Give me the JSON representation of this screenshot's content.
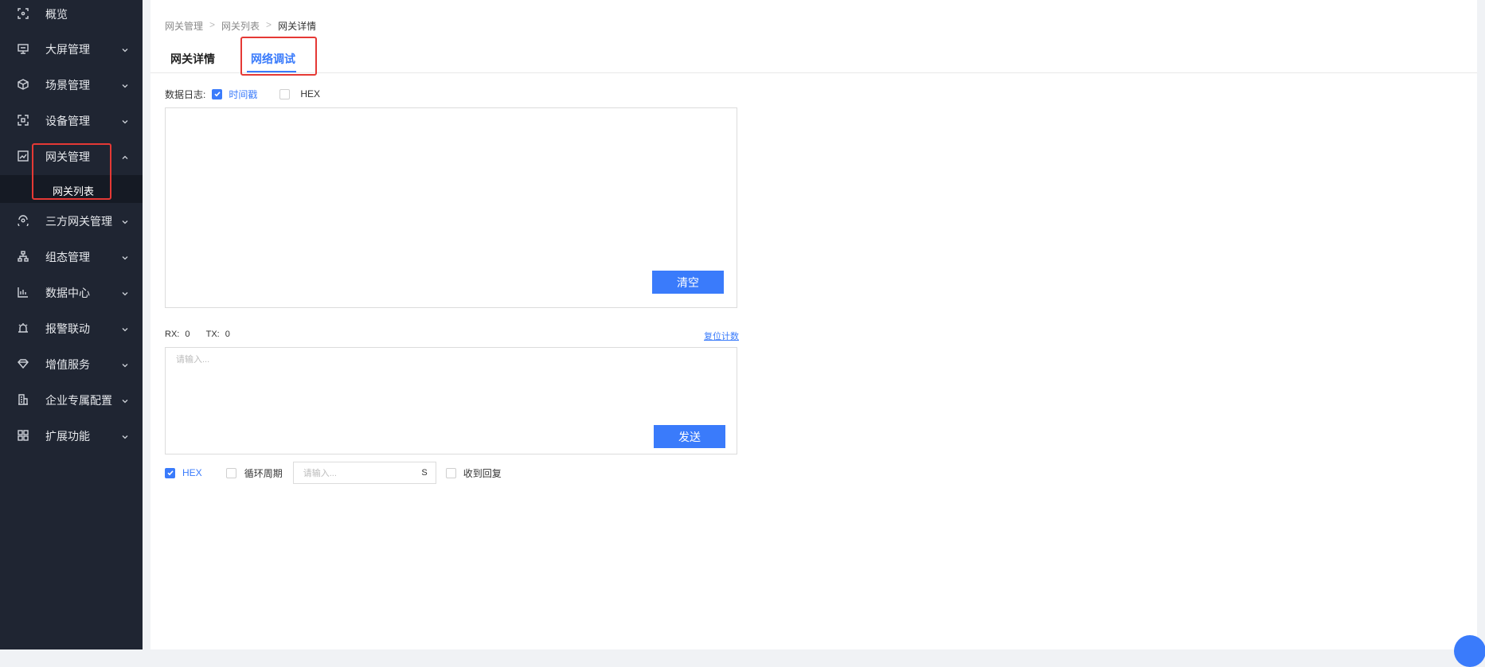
{
  "sidebar": {
    "items": [
      {
        "label": "概览",
        "icon": "overview-icon"
      },
      {
        "label": "大屏管理",
        "icon": "monitor-icon"
      },
      {
        "label": "场景管理",
        "icon": "cube-icon"
      },
      {
        "label": "设备管理",
        "icon": "device-icon"
      },
      {
        "label": "网关管理",
        "icon": "gateway-icon"
      },
      {
        "label": "三方网关管理",
        "icon": "third-party-icon"
      },
      {
        "label": "组态管理",
        "icon": "hierarchy-icon"
      },
      {
        "label": "数据中心",
        "icon": "bar-chart-icon"
      },
      {
        "label": "报警联动",
        "icon": "alarm-icon"
      },
      {
        "label": "增值服务",
        "icon": "diamond-icon"
      },
      {
        "label": "企业专属配置",
        "icon": "building-icon"
      },
      {
        "label": "扩展功能",
        "icon": "grid-icon"
      }
    ],
    "sub_item": "网关列表"
  },
  "breadcrumb": [
    "网关管理",
    "网关列表",
    "网关详情"
  ],
  "tabs": [
    "网关详情",
    "网络调试"
  ],
  "log": {
    "label": "数据日志:",
    "timestamp_label": "时间戳",
    "hex_label": "HEX",
    "clear_button": "清空"
  },
  "counters": {
    "rx_label": "RX:",
    "rx": "0",
    "tx_label": "TX:",
    "tx": "0",
    "reset_link": "复位计数"
  },
  "send": {
    "placeholder": "请输入...",
    "send_button": "发送",
    "hex_label": "HEX",
    "loop_label": "循环周期",
    "period_placeholder": "请输入...",
    "period_unit": "S",
    "reply_label": "收到回复"
  },
  "colors": {
    "sidebar_bg": "#1f2532",
    "accent": "#3a7bfb",
    "annotation": "#e53935"
  }
}
